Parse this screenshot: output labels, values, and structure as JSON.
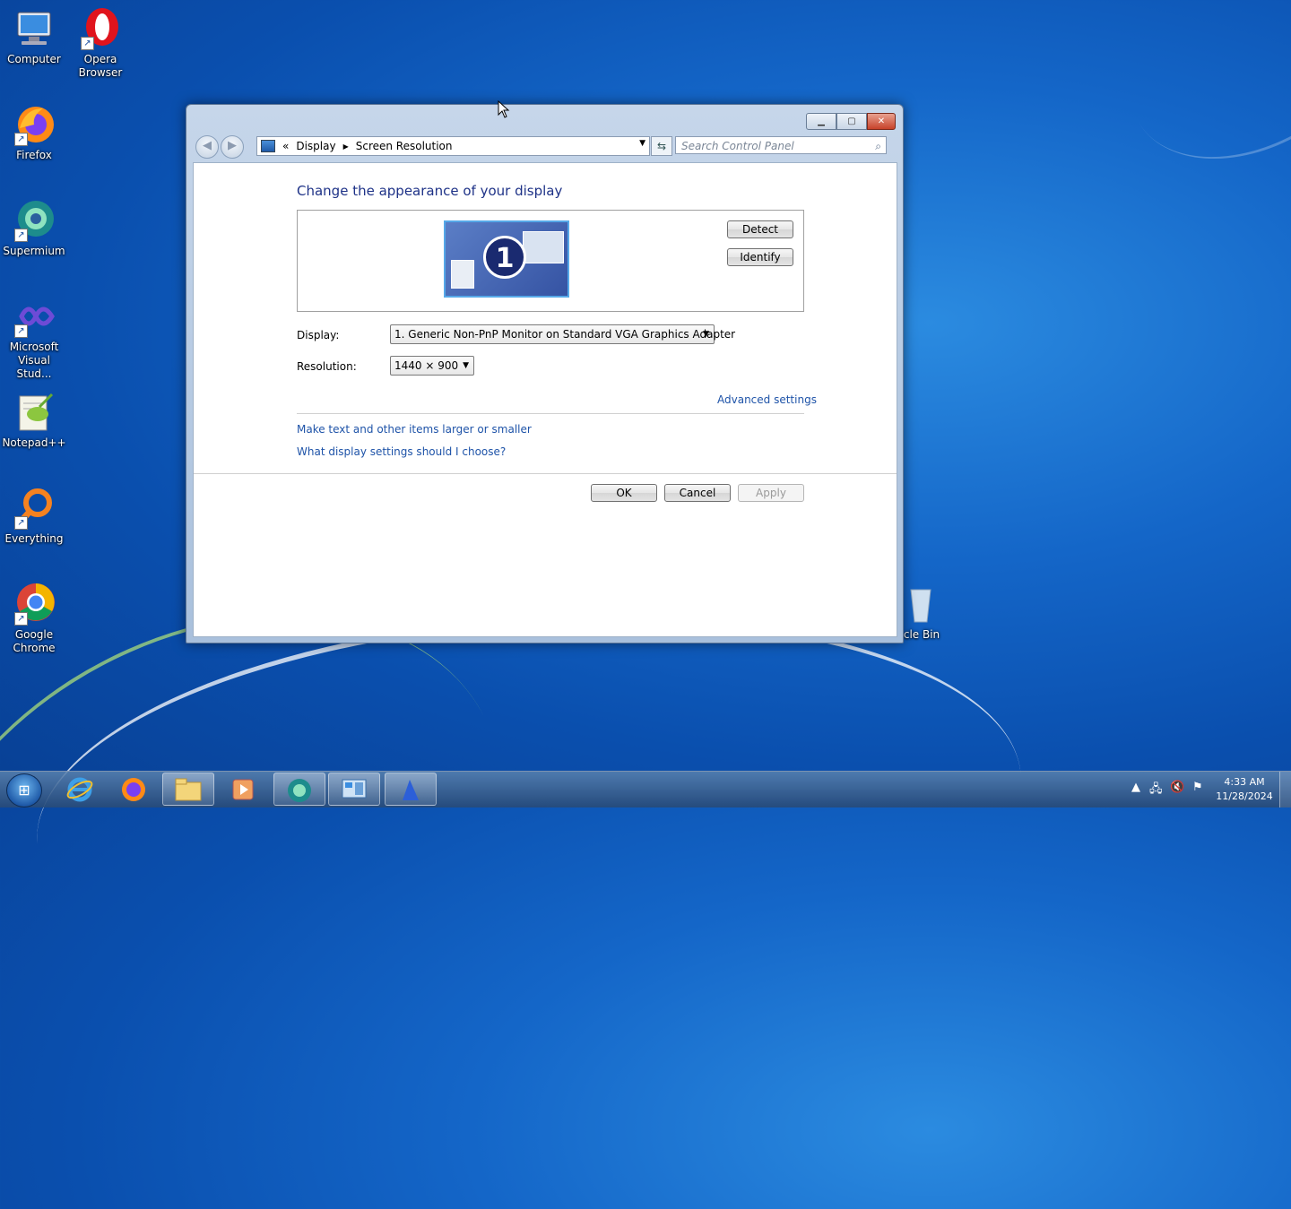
{
  "desktop": {
    "icons": [
      {
        "label": "Computer"
      },
      {
        "label": "Opera Browser"
      },
      {
        "label": "Firefox"
      },
      {
        "label": "Supermium"
      },
      {
        "label": "Microsoft Visual Stud..."
      },
      {
        "label": "Notepad++"
      },
      {
        "label": "Everything"
      },
      {
        "label": "Google Chrome"
      },
      {
        "label": "cle Bin"
      }
    ]
  },
  "window": {
    "breadcrumb": {
      "root": "«",
      "items": [
        "Display",
        "Screen Resolution"
      ]
    },
    "search_placeholder": "Search Control Panel",
    "heading": "Change the appearance of your display",
    "monitor_number": "1",
    "detect_label": "Detect",
    "identify_label": "Identify",
    "display_label": "Display:",
    "display_value": "1. Generic Non-PnP Monitor on Standard VGA Graphics Adapter",
    "resolution_label": "Resolution:",
    "resolution_value": "1440 × 900",
    "advanced_link": "Advanced settings",
    "links": [
      "Make text and other items larger or smaller",
      "What display settings should I choose?"
    ],
    "ok_label": "OK",
    "cancel_label": "Cancel",
    "apply_label": "Apply"
  },
  "taskbar": {
    "clock_time": "4:33 AM",
    "clock_date": "11/28/2024"
  }
}
